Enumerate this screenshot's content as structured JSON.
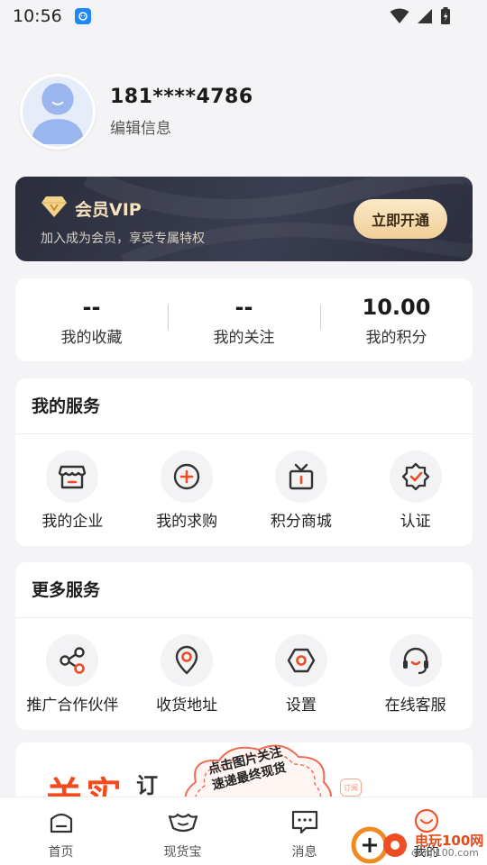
{
  "status_bar": {
    "time": "10:56",
    "icons": [
      "app-notification-icon",
      "wifi-icon",
      "signal-icon",
      "battery-icon"
    ]
  },
  "profile": {
    "phone": "181****4786",
    "edit_label": "编辑信息"
  },
  "vip": {
    "title": "会员VIP",
    "subtitle": "加入成为会员，享受专属特权",
    "button": "立即开通",
    "colors": {
      "card_bg": "#2f3244",
      "title": "#f6e2bc",
      "button_bg": "#f5dcae"
    }
  },
  "stats": [
    {
      "value": "--",
      "label": "我的收藏"
    },
    {
      "value": "--",
      "label": "我的关注"
    },
    {
      "value": "10.00",
      "label": "我的积分"
    }
  ],
  "my_services": {
    "title": "我的服务",
    "items": [
      {
        "label": "我的企业",
        "icon": "storefront-icon"
      },
      {
        "label": "我的求购",
        "icon": "plus-circle-icon"
      },
      {
        "label": "积分商城",
        "icon": "gift-icon"
      },
      {
        "label": "认证",
        "icon": "verified-badge-icon"
      }
    ]
  },
  "more_services": {
    "title": "更多服务",
    "items": [
      {
        "label": "推广合作伙伴",
        "icon": "share-icon"
      },
      {
        "label": "收货地址",
        "icon": "location-pin-icon"
      },
      {
        "label": "设置",
        "icon": "settings-hexagon-icon"
      },
      {
        "label": "在线客服",
        "icon": "headset-icon"
      }
    ]
  },
  "banner": {
    "big_text": "关实",
    "small_text": "订",
    "cloud_text_line1": "点击图片关注",
    "cloud_text_line2": "速递最终现货",
    "tag": "订阅"
  },
  "tab_bar": {
    "tabs": [
      {
        "label": "首页",
        "icon": "home-icon"
      },
      {
        "label": "现货宝",
        "icon": "ingot-icon"
      },
      {
        "label": "消息",
        "icon": "message-icon"
      },
      {
        "label": "我的",
        "icon": "profile-icon"
      }
    ],
    "active_index": 3
  },
  "watermark": {
    "text": "电玩100网",
    "url": "danji100.com"
  },
  "colors": {
    "accent": "#f04a1d",
    "page_bg": "#f4f4f6"
  }
}
